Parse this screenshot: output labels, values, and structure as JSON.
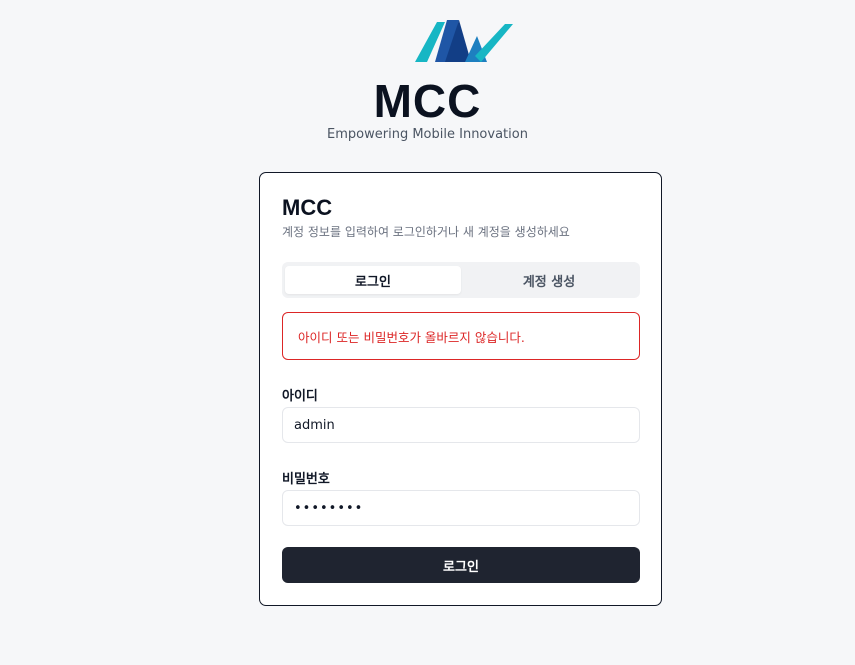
{
  "brand": {
    "logo_icon": "mcc-mountain-logo-icon",
    "title": "MCC",
    "tagline": "Empowering Mobile Innovation",
    "colors": {
      "teal": "#17b6c4",
      "blue": "#1f56a6",
      "navy": "#0b1220"
    }
  },
  "card": {
    "title": "MCC",
    "description": "계정 정보를 입력하여 로그인하거나 새 계정을 생성하세요"
  },
  "tabs": [
    {
      "label": "로그인",
      "active": true
    },
    {
      "label": "계정 생성",
      "active": false
    }
  ],
  "alert": {
    "message": "아이디 또는 비밀번호가 올바르지 않습니다.",
    "color": "#dc2626"
  },
  "form": {
    "id_label": "아이디",
    "id_value": "admin",
    "password_label": "비밀번호",
    "password_value": "••••••••",
    "submit_label": "로그인"
  }
}
